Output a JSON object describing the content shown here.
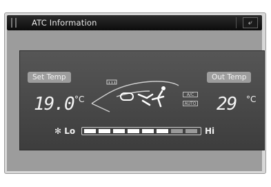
{
  "window": {
    "title": "ATC Information",
    "back_icon": "return-icon"
  },
  "left": {
    "label": "Set Temp",
    "value": "19.0",
    "unit": "°C"
  },
  "right": {
    "label": "Out Temp",
    "value": "29",
    "unit": "°C"
  },
  "fan": {
    "icon": "fan-icon",
    "lo_label": "Lo",
    "hi_label": "Hi",
    "level": 6,
    "max_level": 8
  },
  "car": {
    "badges": [
      "A/C",
      "AUTO"
    ],
    "mode": "recirculation",
    "airflow": "face"
  }
}
